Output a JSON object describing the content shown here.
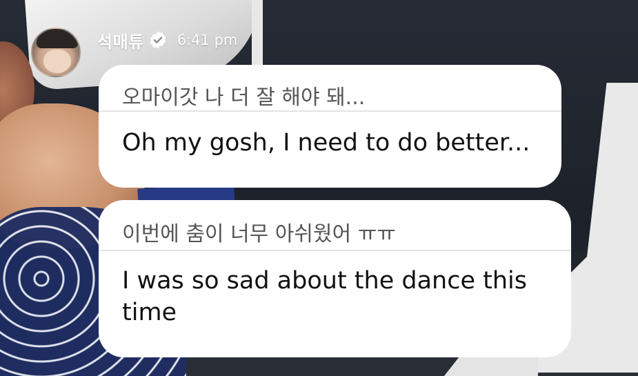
{
  "post": {
    "author_name": "석매튜",
    "time": "6:41 pm",
    "verified_icon": "verified-check-icon"
  },
  "messages": [
    {
      "original": "오마이갓 나 더 잘 해야 돼...",
      "translation": "Oh my gosh, I need to do better..."
    },
    {
      "original": "이번에 춤이 너무 아쉬웠어 ㅠㅠ",
      "translation": "I was so sad about the dance this time"
    }
  ],
  "colors": {
    "bubble": "#ffffff",
    "original_text": "#555555",
    "translation_text": "#111111",
    "divider": "#e3e3e3"
  }
}
